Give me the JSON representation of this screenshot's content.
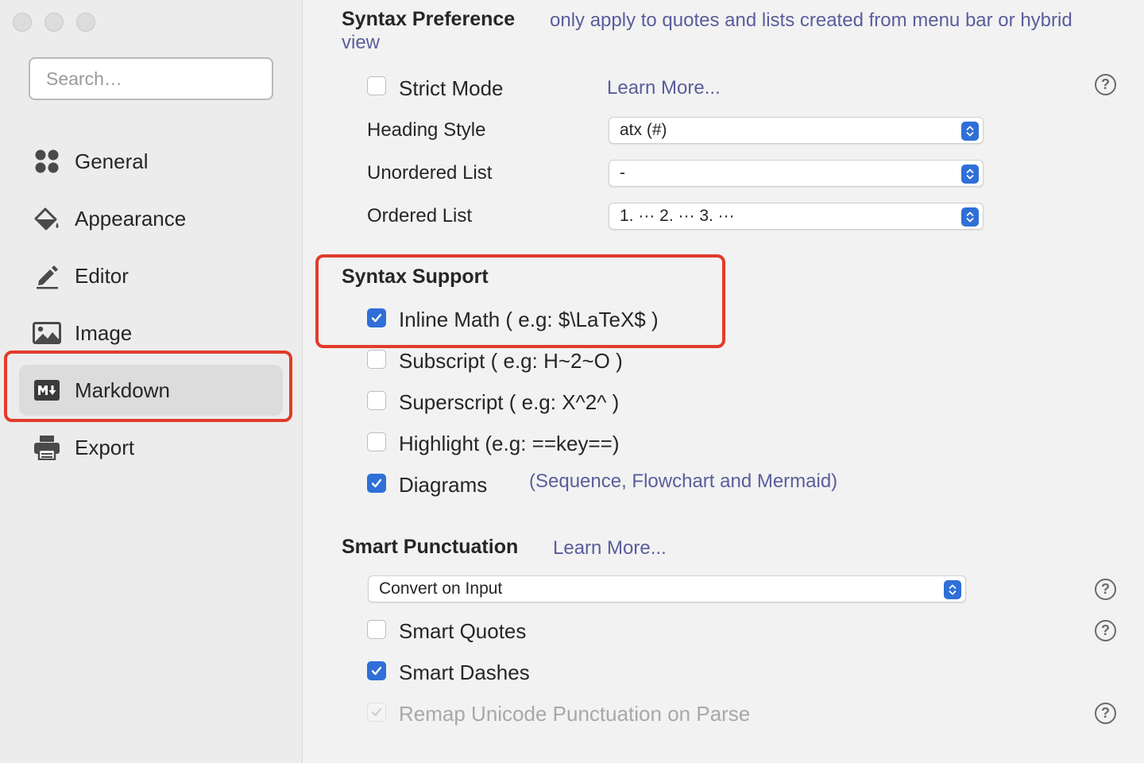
{
  "sidebar": {
    "search_placeholder": "Search…",
    "items": [
      {
        "label": "General",
        "icon": "grid-icon"
      },
      {
        "label": "Appearance",
        "icon": "paint-bucket-icon"
      },
      {
        "label": "Editor",
        "icon": "pencil-icon"
      },
      {
        "label": "Image",
        "icon": "image-icon"
      },
      {
        "label": "Markdown",
        "icon": "markdown-icon",
        "selected": true
      },
      {
        "label": "Export",
        "icon": "printer-icon"
      }
    ]
  },
  "syntax_preference": {
    "title": "Syntax Preference",
    "note_line1": "only apply to quotes and lists created from menu bar or hybrid",
    "note_line2": "view",
    "strict_mode": {
      "label": "Strict Mode",
      "checked": false,
      "learn_more": "Learn More..."
    },
    "heading_style": {
      "label": "Heading Style",
      "value": "atx (#)"
    },
    "unordered_list": {
      "label": "Unordered List",
      "value": "-"
    },
    "ordered_list": {
      "label": "Ordered List",
      "value": "1. ··· 2. ··· 3. ···"
    }
  },
  "syntax_support": {
    "title": "Syntax Support",
    "items": [
      {
        "label": "Inline Math ( e.g: $\\LaTeX$ )",
        "checked": true
      },
      {
        "label": "Subscript ( e.g: H~2~O )",
        "checked": false
      },
      {
        "label": "Superscript ( e.g: X^2^ )",
        "checked": false
      },
      {
        "label": "Highlight (e.g: ==key==)",
        "checked": false
      },
      {
        "label": "Diagrams",
        "checked": true,
        "note": "(Sequence, Flowchart and Mermaid)"
      }
    ]
  },
  "smart_punctuation": {
    "title": "Smart Punctuation",
    "learn_more": "Learn More...",
    "mode": "Convert on Input",
    "smart_quotes": {
      "label": "Smart Quotes",
      "checked": false
    },
    "smart_dashes": {
      "label": "Smart Dashes",
      "checked": true
    },
    "remap_unicode": {
      "label": "Remap Unicode Punctuation on Parse",
      "checked": true,
      "disabled": true
    }
  },
  "help_glyph": "?",
  "colors": {
    "accent": "#2f6fd8",
    "highlight_box": "#e23b2a",
    "link": "#5a5d9c"
  }
}
